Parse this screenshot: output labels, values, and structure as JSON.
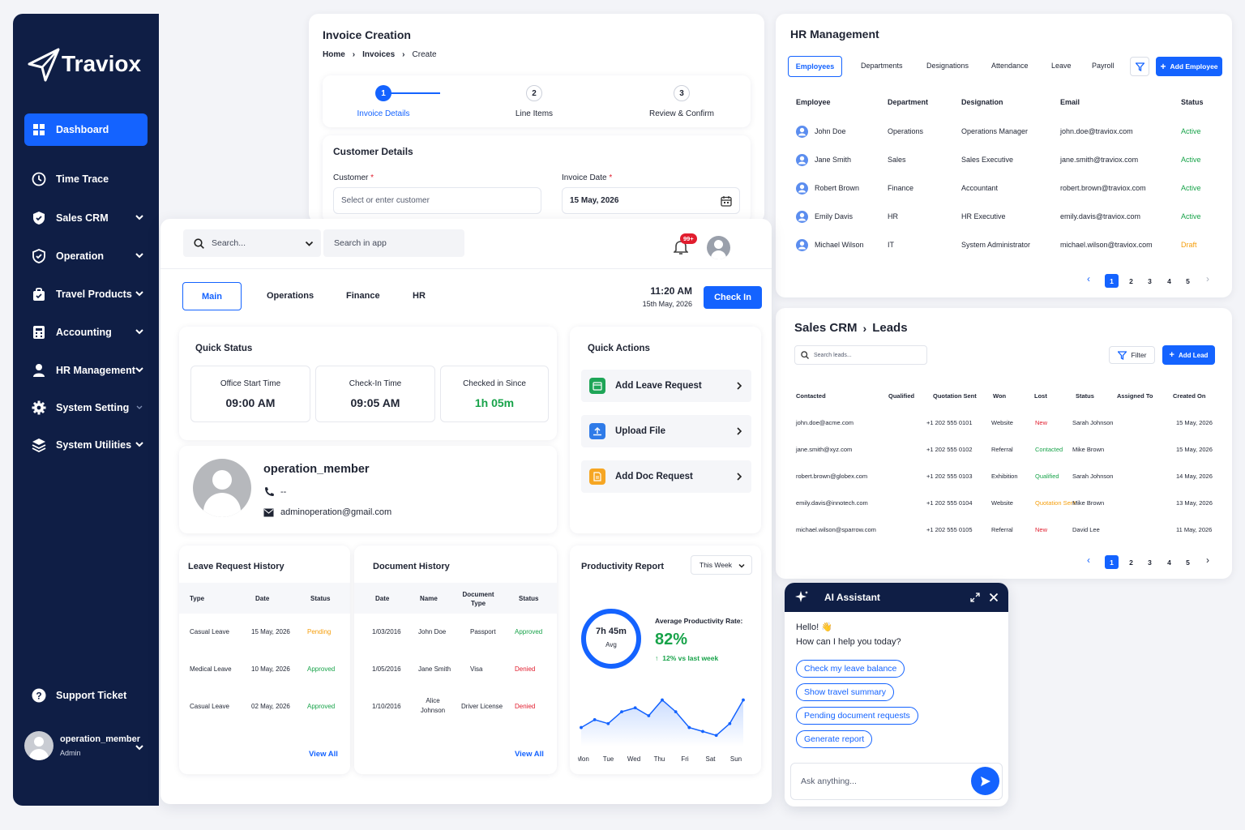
{
  "sidebar": {
    "brand": "Traviox",
    "items": [
      {
        "label": "Dashboard"
      },
      {
        "label": "Time Trace"
      },
      {
        "label": "Sales CRM"
      },
      {
        "label": "Operation"
      },
      {
        "label": "Travel Products"
      },
      {
        "label": "Accounting"
      },
      {
        "label": "HR Management"
      },
      {
        "label": "System Setting"
      },
      {
        "label": "System Utilities"
      }
    ],
    "support": "Support Ticket",
    "user": {
      "name": "operation_member",
      "role": "Admin"
    }
  },
  "invoice": {
    "title": "Invoice Creation",
    "breadcrumb": [
      "Home",
      "Invoices",
      "Create"
    ],
    "steps": [
      {
        "num": "1",
        "label": "Invoice Details"
      },
      {
        "num": "2",
        "label": "Line Items"
      },
      {
        "num": "3",
        "label": "Review & Confirm"
      }
    ],
    "section": "Customer Details",
    "customer_label": "Customer",
    "customer_placeholder": "Select or enter customer",
    "date_label": "Invoice Date",
    "date_value": "15 May, 2026",
    "required": "*"
  },
  "hr": {
    "title": "HR Management",
    "tabs": [
      "Employees",
      "Departments",
      "Designations",
      "Attendance",
      "Leave",
      "Payroll"
    ],
    "add_button": "Add Employee",
    "headers": [
      "Employee",
      "Department",
      "Designation",
      "Email",
      "Status"
    ],
    "rows": [
      [
        "John Doe",
        "Operations",
        "Operations Manager",
        "john.doe@traviox.com",
        "Active"
      ],
      [
        "Jane Smith",
        "Sales",
        "Sales Executive",
        "jane.smith@traviox.com",
        "Active"
      ],
      [
        "Robert Brown",
        "Finance",
        "Accountant",
        "robert.brown@traviox.com",
        "Active"
      ],
      [
        "Emily Davis",
        "HR",
        "HR Executive",
        "emily.davis@traviox.com",
        "Active"
      ],
      [
        "Michael Wilson",
        "IT",
        "System Administrator",
        "michael.wilson@traviox.com",
        "Draft"
      ]
    ],
    "pages": [
      "1",
      "2",
      "3",
      "4",
      "5"
    ]
  },
  "sales": {
    "title": "Sales CRM",
    "subtitle": "Leads",
    "search_placeholder": "Search leads...",
    "filter": "Filter",
    "add_button": "Add Lead",
    "headers": [
      "Contacted",
      "Qualified",
      "Quotation Sent",
      "Won",
      "Lost",
      "Status",
      "Assigned To",
      "Created On"
    ],
    "rows": [
      [
        "john.doe@acme.com",
        "+1 202 555 0101",
        "Website",
        "New",
        "Sarah Johnson",
        "15 May, 2026"
      ],
      [
        "jane.smith@xyz.com",
        "+1 202 555 0102",
        "Referral",
        "Contacted",
        "Mike Brown",
        "15 May, 2026"
      ],
      [
        "robert.brown@globex.com",
        "+1 202 555 0103",
        "Exhibition",
        "Qualified",
        "Sarah Johnson",
        "14 May, 2026"
      ],
      [
        "emily.davis@innotech.com",
        "+1 202 555 0104",
        "Website",
        "Quotation Sent",
        "Mike Brown",
        "13 May, 2026"
      ],
      [
        "michael.wilson@sparrow.com",
        "+1 202 555 0105",
        "Referral",
        "New",
        "David Lee",
        "11 May, 2026"
      ]
    ],
    "pages": [
      "1",
      "2",
      "3",
      "4",
      "5"
    ]
  },
  "dash": {
    "search_placeholder": "Search...",
    "search_app_placeholder": "Search in app",
    "notif_badge": "99+",
    "tabs": [
      "Main",
      "Operations",
      "Finance",
      "HR"
    ],
    "time": "11:20 AM",
    "date": "15th May, 2026",
    "checkin": "Check In",
    "quick_status": {
      "title": "Quick Status",
      "items": [
        {
          "label": "Office Start Time",
          "value": "09:00 AM"
        },
        {
          "label": "Check-In Time",
          "value": "09:05 AM"
        },
        {
          "label": "Checked in Since",
          "value": "1h 05m"
        }
      ]
    },
    "quick_actions": {
      "title": "Quick Actions",
      "items": [
        "Add Leave Request",
        "Upload File",
        "Add Doc Request"
      ]
    },
    "profile": {
      "name": "operation_member",
      "phone": "--",
      "email": "adminoperation@gmail.com"
    },
    "leave": {
      "title": "Leave Request History",
      "headers": [
        "Type",
        "Date",
        "Status"
      ],
      "rows": [
        [
          "Casual Leave",
          "15 May, 2026",
          "Pending"
        ],
        [
          "Medical Leave",
          "10 May, 2026",
          "Approved"
        ],
        [
          "Casual Leave",
          "02 May, 2026",
          "Approved"
        ]
      ],
      "view_all": "View All"
    },
    "docs": {
      "title": "Document History",
      "headers": [
        "Date",
        "Name",
        "Document Type",
        "Status"
      ],
      "rows": [
        [
          "1/03/2016",
          "John Doe",
          "Passport",
          "Approved"
        ],
        [
          "1/05/2016",
          "Jane Smith",
          "Visa",
          "Denied"
        ],
        [
          "1/10/2016",
          "Alice Johnson",
          "Driver License",
          "Denied"
        ]
      ],
      "view_all": "View All"
    },
    "productivity": {
      "title": "Productivity Report",
      "range": "This Week",
      "ring_value": "7h 45m",
      "ring_sub": "Avg",
      "rate_label": "Average Productivity Rate:",
      "rate": "82%",
      "delta": "12% vs last week"
    }
  },
  "chart_data": {
    "type": "area",
    "categories": [
      "Mon",
      "Tue",
      "Wed",
      "Thu",
      "Fri",
      "Sat",
      "Sun"
    ],
    "x": [
      "Mon",
      "Mon2",
      "Tue",
      "Tue2",
      "Wed",
      "Wed2",
      "Thu",
      "Thu2",
      "Fri",
      "Fri2",
      "Sat",
      "Sat2",
      "Sun"
    ],
    "values": [
      4,
      6,
      5,
      8,
      9,
      7,
      11,
      8,
      4,
      3,
      2,
      5,
      11
    ],
    "ylim": [
      0,
      14
    ],
    "grid": false,
    "title": "",
    "xlabel": "",
    "ylabel": ""
  },
  "ai": {
    "title": "AI Assistant",
    "greeting": "Hello! 👋",
    "question": "How can I help you today?",
    "chips": [
      "Check my leave balance",
      "Show travel summary",
      "Pending document requests",
      "Generate report"
    ],
    "input_placeholder": "Ask anything..."
  },
  "colors": {
    "accent": "#1463ff",
    "sidebar": "#0f1e45",
    "success": "#18a34a",
    "warning": "#f59e0b",
    "danger": "#e11d2e"
  }
}
